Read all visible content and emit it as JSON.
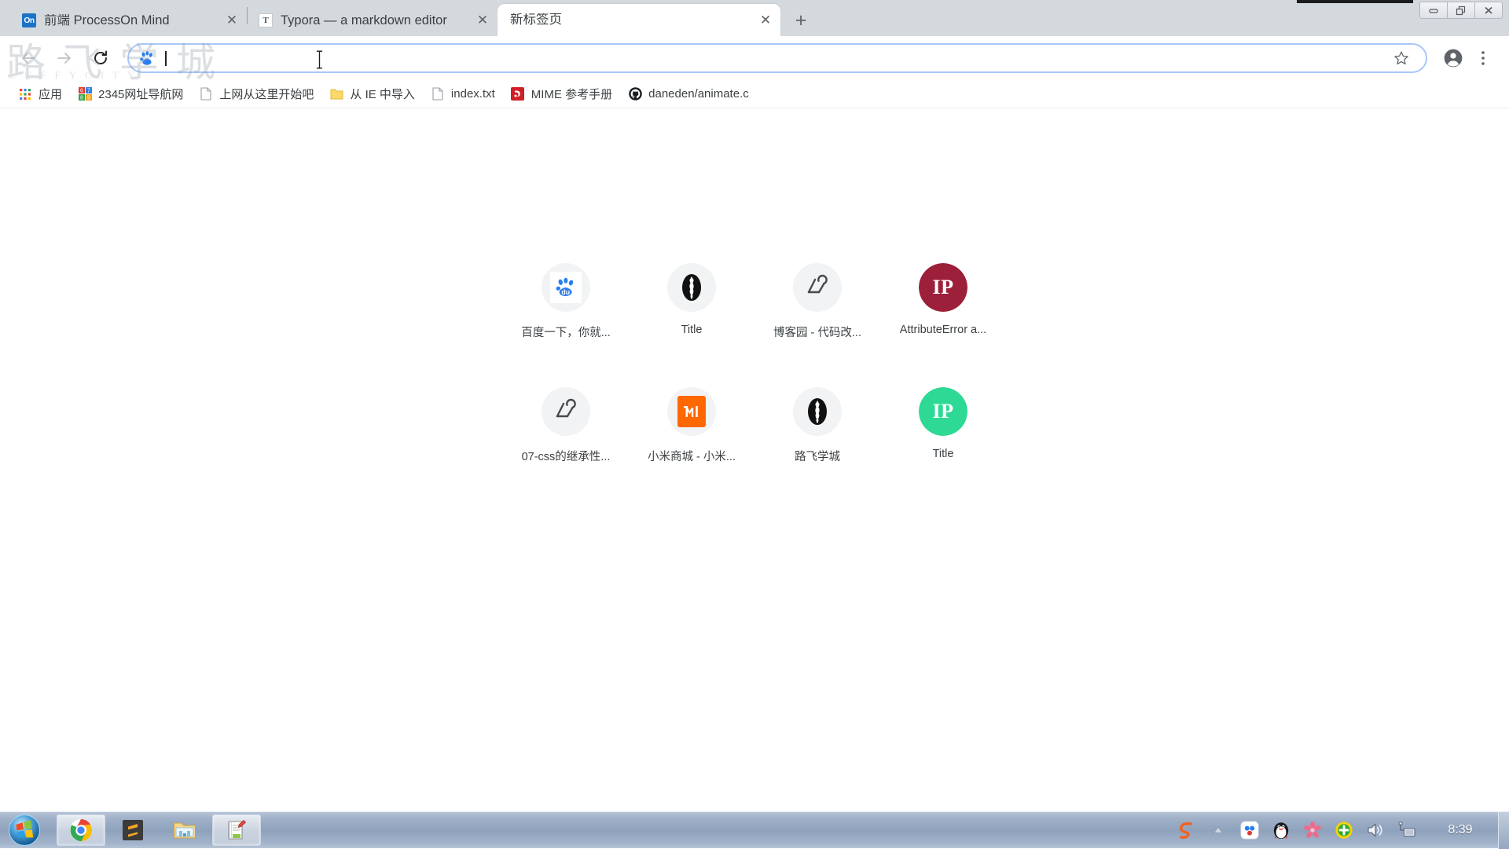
{
  "window": {
    "controls": [
      {
        "name": "minimize",
        "glyph": "—"
      },
      {
        "name": "restore",
        "glyph": "❐"
      },
      {
        "name": "close",
        "glyph": "✕"
      }
    ]
  },
  "tabs": [
    {
      "title": "前端 ProcessOn Mind",
      "favicon": "processon-icon",
      "favicon_text": "On",
      "active": false,
      "close_label": "✕"
    },
    {
      "title": "Typora — a markdown editor",
      "favicon": "typora-icon",
      "favicon_text": "T",
      "active": false,
      "close_label": "✕"
    },
    {
      "title": "新标签页",
      "favicon": "none",
      "favicon_text": "",
      "active": true,
      "close_label": "✕"
    }
  ],
  "new_tab_button": {
    "label": "+",
    "name": "new-tab-button"
  },
  "toolbar": {
    "back_label": "←",
    "forward_label": "→",
    "reload_label": "⟳",
    "omnibox": {
      "value": "",
      "placeholder": "",
      "search_engine_icon": "baidu-paw-icon"
    },
    "star_label": "☆",
    "profile_label": "●",
    "menu_label": "⋮"
  },
  "bookmarks": [
    {
      "label": "应用",
      "icon": "apps-grid-icon"
    },
    {
      "label": "2345网址导航网",
      "icon": "2345-icon"
    },
    {
      "label": "上网从这里开始吧",
      "icon": "page-icon"
    },
    {
      "label": "从 IE 中导入",
      "icon": "folder-icon"
    },
    {
      "label": "index.txt",
      "icon": "page-icon"
    },
    {
      "label": "MIME 参考手册",
      "icon": "mime-icon"
    },
    {
      "label": "daneden/animate.c",
      "icon": "github-icon"
    }
  ],
  "ntp": {
    "tiles": [
      {
        "label": "百度一下，你就...",
        "icon": "baidu-icon",
        "icon_type": "baidu",
        "bg": "#f1f3f4"
      },
      {
        "label": "Title",
        "icon": "luffy-icon",
        "icon_type": "luffy",
        "bg": "#f1f3f4"
      },
      {
        "label": "博客园 - 代码改...",
        "icon": "cnblogs-icon",
        "icon_type": "cnblogs",
        "bg": "#f1f3f4"
      },
      {
        "label": "AttributeError a...",
        "icon": "ip-badge-icon",
        "icon_type": "ip",
        "bg": "#9c2039",
        "badge_text": "IP"
      },
      {
        "label": "07-css的继承性...",
        "icon": "cnblogs-icon",
        "icon_type": "cnblogs",
        "bg": "#f1f3f4"
      },
      {
        "label": "小米商城 - 小米...",
        "icon": "xiaomi-icon",
        "icon_type": "xiaomi",
        "bg": "#f1f3f4"
      },
      {
        "label": "路飞学城",
        "icon": "luffy-icon",
        "icon_type": "luffy",
        "bg": "#f1f3f4"
      },
      {
        "label": "Title",
        "icon": "ip-badge-icon",
        "icon_type": "ip",
        "bg": "#2ed995",
        "badge_text": "IP"
      }
    ]
  },
  "watermark": {
    "big_text": "路飞学城",
    "small_text": "LUFFYCITY"
  },
  "taskbar": {
    "start_label": "start-orb",
    "items": [
      {
        "name": "chrome",
        "running": true
      },
      {
        "name": "sublime-text",
        "running": false
      },
      {
        "name": "file-explorer",
        "running": false
      },
      {
        "name": "notepad-editor",
        "running": true
      }
    ],
    "tray": [
      {
        "name": "sogou-input-icon",
        "glyph": "S"
      },
      {
        "name": "show-hidden-icons-icon",
        "glyph": "▲"
      },
      {
        "name": "baidu-netdisk-icon",
        "glyph": ""
      },
      {
        "name": "qq-icon",
        "glyph": ""
      },
      {
        "name": "360-flower-icon",
        "glyph": ""
      },
      {
        "name": "360-security-icon",
        "glyph": "+"
      },
      {
        "name": "volume-icon",
        "glyph": ""
      },
      {
        "name": "network-icon",
        "glyph": ""
      }
    ],
    "clock": "8:39"
  },
  "colors": {
    "tabstrip_bg": "#d4d9de",
    "omnibox_border": "#a8c7fa",
    "ip_red": "#9c2039",
    "ip_green": "#2ed995",
    "xiaomi_orange": "#ff6700",
    "taskbar_blue": "#8fa2bd"
  }
}
